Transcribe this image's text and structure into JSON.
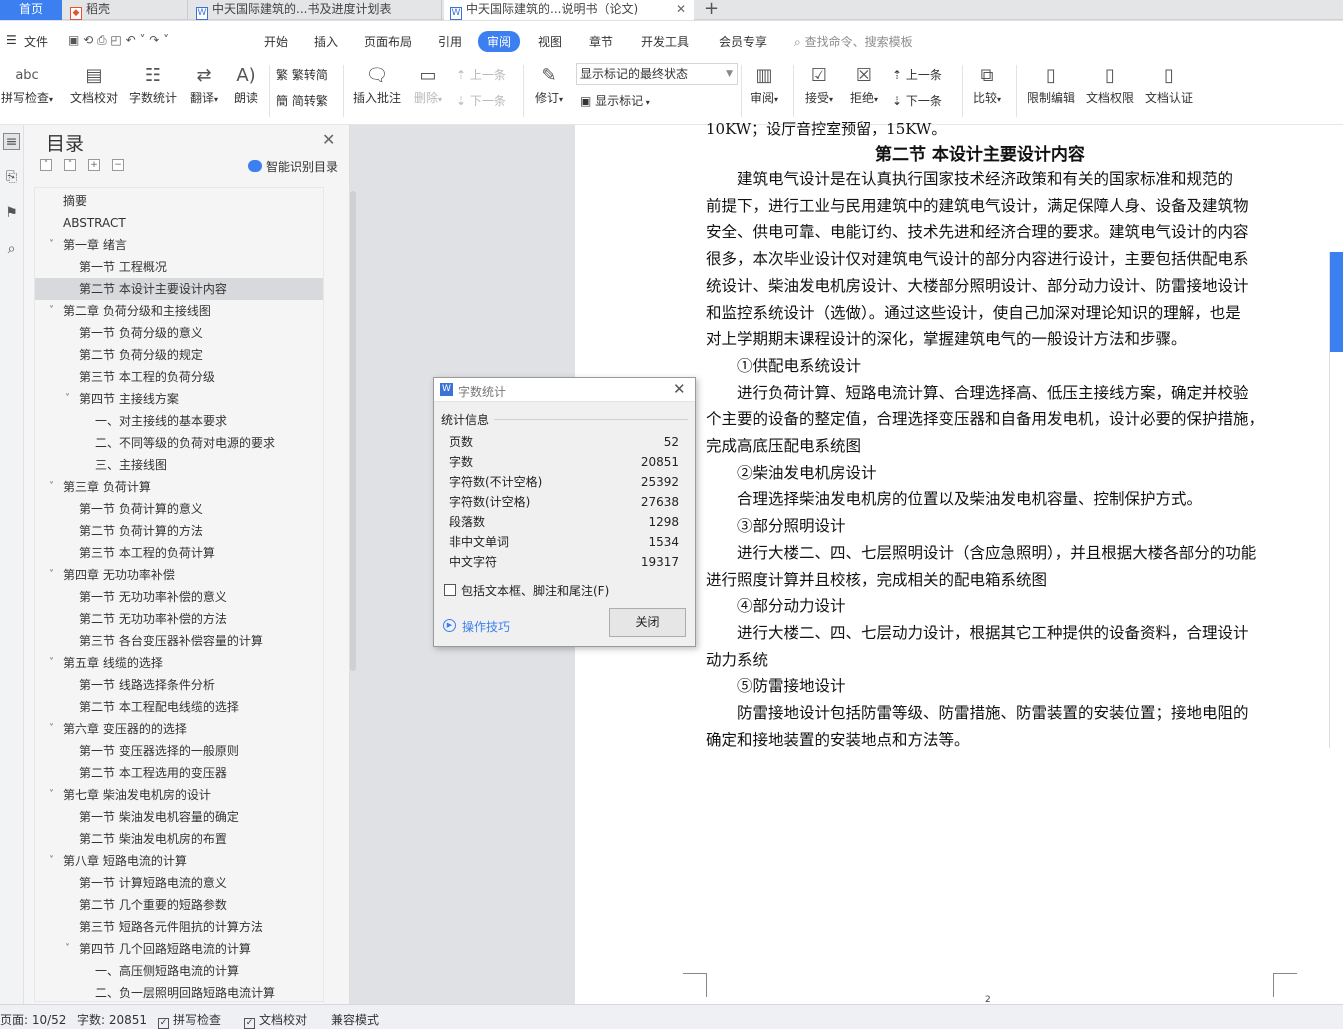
{
  "tabs": {
    "home": "首页",
    "docer": "稻壳",
    "plan": "中天国际建筑的...书及进度计划表",
    "doc": "中天国际建筑的...说明书（论文)"
  },
  "menu": {
    "file": "文件",
    "items": [
      "开始",
      "插入",
      "页面布局",
      "引用",
      "审阅",
      "视图",
      "章节",
      "开发工具",
      "会员专享"
    ],
    "active": "审阅",
    "search": "查找命令、搜索模板"
  },
  "toolbar": {
    "spell_check": "拼写检查",
    "doc_proof": "文档校对",
    "word_count": "字数统计",
    "translate": "翻译",
    "read_aloud": "朗读",
    "to_traditional": "繁转简",
    "to_simplified": "简转繁",
    "insert_comment": "插入批注",
    "delete": "删除",
    "prev_comment": "上一条",
    "next_comment": "下一条",
    "track_changes": "修订",
    "markup_state": "显示标记的最终状态",
    "show_markup": "显示标记",
    "review": "审阅",
    "accept": "接受",
    "reject": "拒绝",
    "prev_change": "上一条",
    "next_change": "下一条",
    "compare": "比较",
    "restrict_edit": "限制编辑",
    "doc_permission": "文档权限",
    "doc_certify": "文档认证"
  },
  "nav": {
    "title": "目录",
    "smart_toc": "智能识别目录",
    "items": [
      {
        "label": "摘要",
        "level": 0,
        "chev": false
      },
      {
        "label": "ABSTRACT",
        "level": 0,
        "chev": false
      },
      {
        "label": "第一章  绪言",
        "level": 0,
        "chev": true
      },
      {
        "label": "第一节  工程概况",
        "level": 1,
        "chev": false
      },
      {
        "label": "第二节  本设计主要设计内容",
        "level": 1,
        "chev": false,
        "selected": true
      },
      {
        "label": "第二章  负荷分级和主接线图",
        "level": 0,
        "chev": true
      },
      {
        "label": "第一节  负荷分级的意义",
        "level": 1,
        "chev": false
      },
      {
        "label": "第二节  负荷分级的规定",
        "level": 1,
        "chev": false
      },
      {
        "label": "第三节  本工程的负荷分级",
        "level": 1,
        "chev": false
      },
      {
        "label": "第四节  主接线方案",
        "level": 1,
        "chev": true
      },
      {
        "label": "一、对主接线的基本要求",
        "level": 2,
        "chev": false
      },
      {
        "label": "二、不同等级的负荷对电源的要求",
        "level": 2,
        "chev": false
      },
      {
        "label": "三、主接线图",
        "level": 2,
        "chev": false
      },
      {
        "label": "第三章  负荷计算",
        "level": 0,
        "chev": true
      },
      {
        "label": "第一节  负荷计算的意义",
        "level": 1,
        "chev": false
      },
      {
        "label": "第二节  负荷计算的方法",
        "level": 1,
        "chev": false
      },
      {
        "label": "第三节  本工程的负荷计算",
        "level": 1,
        "chev": false
      },
      {
        "label": "第四章  无功功率补偿",
        "level": 0,
        "chev": true
      },
      {
        "label": "第一节  无功功率补偿的意义",
        "level": 1,
        "chev": false
      },
      {
        "label": "第二节  无功功率补偿的方法",
        "level": 1,
        "chev": false
      },
      {
        "label": "第三节  各台变压器补偿容量的计算",
        "level": 1,
        "chev": false
      },
      {
        "label": "第五章  线缆的选择",
        "level": 0,
        "chev": true
      },
      {
        "label": "第一节  线路选择条件分析",
        "level": 1,
        "chev": false
      },
      {
        "label": "第二节  本工程配电线缆的选择",
        "level": 1,
        "chev": false
      },
      {
        "label": "第六章  变压器的的选择",
        "level": 0,
        "chev": true
      },
      {
        "label": "第一节  变压器选择的一般原则",
        "level": 1,
        "chev": false
      },
      {
        "label": "第二节  本工程选用的变压器",
        "level": 1,
        "chev": false
      },
      {
        "label": "第七章  柴油发电机房的设计",
        "level": 0,
        "chev": true
      },
      {
        "label": "第一节  柴油发电机容量的确定",
        "level": 1,
        "chev": false
      },
      {
        "label": "第二节  柴油发电机房的布置",
        "level": 1,
        "chev": false
      },
      {
        "label": "第八章  短路电流的计算",
        "level": 0,
        "chev": true
      },
      {
        "label": "第一节  计算短路电流的意义",
        "level": 1,
        "chev": false
      },
      {
        "label": "第二节  几个重要的短路参数",
        "level": 1,
        "chev": false
      },
      {
        "label": "第三节  短路各元件阻抗的计算方法",
        "level": 1,
        "chev": false
      },
      {
        "label": "第四节  几个回路短路电流的计算",
        "level": 1,
        "chev": true
      },
      {
        "label": "一、高压侧短路电流的计算",
        "level": 2,
        "chev": false
      },
      {
        "label": "二、负一层照明回路短路电流计算",
        "level": 2,
        "chev": false
      }
    ]
  },
  "document": {
    "partial_top": "10KW；设厅音控室预留，15KW。",
    "section_title": "第二节  本设计主要设计内容",
    "lines": [
      "　　建筑电气设计是在认真执行国家技术经济政策和有关的国家标准和规范的",
      "前提下，进行工业与民用建筑中的建筑电气设计，满足保障人身、设备及建筑物",
      "安全、供电可靠、电能订约、技术先进和经济合理的要求。建筑电气设计的内容",
      "很多，本次毕业设计仅对建筑电气设计的部分内容进行设计，主要包括供配电系",
      "统设计、柴油发电机房设计、大楼部分照明设计、部分动力设计、防雷接地设计",
      "和监控系统设计（选做）。通过这些设计，使自己加深对理论知识的理解，也是",
      "对上学期期末课程设计的深化，掌握建筑电气的一般设计方法和步骤。",
      "　　①供配电系统设计",
      "　　进行负荷计算、短路电流计算、合理选择高、低压主接线方案，确定并校验",
      "个主要的设备的整定值，合理选择变压器和自备用发电机，设计必要的保护措施，",
      "完成高底压配电系统图",
      "　　②柴油发电机房设计",
      "　　合理选择柴油发电机房的位置以及柴油发电机容量、控制保护方式。",
      "　　③部分照明设计",
      "　　进行大楼二、四、七层照明设计（含应急照明），并且根据大楼各部分的功能",
      "进行照度计算并且校核，完成相关的配电箱系统图",
      "　　④部分动力设计",
      "　　进行大楼二、四、七层动力设计，根据其它工种提供的设备资料，合理设计",
      "动力系统",
      "　　⑤防雷接地设计",
      "　　防雷接地设计包括防雷等级、防雷措施、防雷装置的安装位置；接地电阻的",
      "确定和接地装置的安装地点和方法等。"
    ],
    "page_number": "2"
  },
  "dialog": {
    "title": "字数统计",
    "group": "统计信息",
    "stats": [
      {
        "label": "页数",
        "value": "52"
      },
      {
        "label": "字数",
        "value": "20851"
      },
      {
        "label": "字符数(不计空格)",
        "value": "25392"
      },
      {
        "label": "字符数(计空格)",
        "value": "27638"
      },
      {
        "label": "段落数",
        "value": "1298"
      },
      {
        "label": "非中文单词",
        "value": "1534"
      },
      {
        "label": "中文字符",
        "value": "19317"
      }
    ],
    "checkbox": "包括文本框、脚注和尾注(F)",
    "tips": "操作技巧",
    "close": "关闭"
  },
  "status": {
    "page": "页面: 10/52",
    "words": "字数: 20851",
    "spell": "拼写检查",
    "proof": "文档校对",
    "compat": "兼容模式"
  }
}
